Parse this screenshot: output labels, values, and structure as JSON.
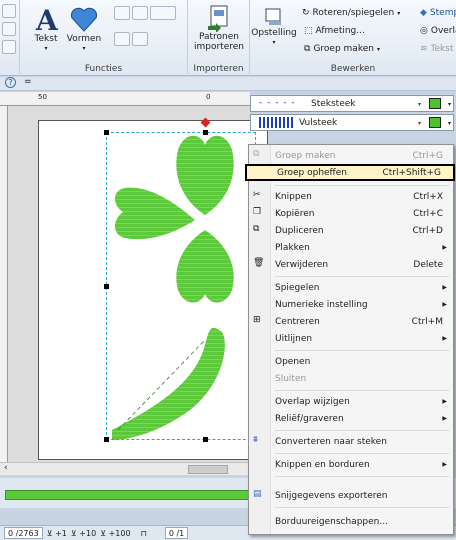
{
  "ribbon": {
    "functies": {
      "tekst": "Tekst",
      "vormen": "Vormen",
      "label": "Functies"
    },
    "importeren": {
      "patronen": "Patronen",
      "importeren_btn": "importeren",
      "label": "Importeren"
    },
    "bewerken": {
      "opstelling": "Opstelling",
      "roteren": "Roteren/spiegelen",
      "afmeting": "Afmeting...",
      "groep_maken": "Groep maken",
      "stempel": "Stempe",
      "overlap": "Overlap",
      "tekst_pl": "Tekst pl",
      "label": "Bewerken"
    }
  },
  "toolbar": {
    "help": "?",
    "dropdown": "="
  },
  "ruler": {
    "left": "50",
    "right": "0"
  },
  "stitches": {
    "line": "Steksteek",
    "fill": "Vulsteek"
  },
  "menu": {
    "items": [
      {
        "label": "Groep maken",
        "shortcut": "Ctrl+G",
        "disabled": true
      },
      {
        "label": "Groep opheffen",
        "shortcut": "Ctrl+Shift+G"
      },
      {
        "label": "Knippen",
        "shortcut": "Ctrl+X"
      },
      {
        "label": "Kopiëren",
        "shortcut": "Ctrl+C"
      },
      {
        "label": "Dupliceren",
        "shortcut": "Ctrl+D"
      },
      {
        "label": "Plakken"
      },
      {
        "label": "Verwijderen",
        "shortcut": "Delete"
      },
      {
        "label": "Spiegelen"
      },
      {
        "label": "Numerieke instelling"
      },
      {
        "label": "Centreren",
        "shortcut": "Ctrl+M"
      },
      {
        "label": "Uitlijnen"
      },
      {
        "label": "Openen"
      },
      {
        "label": "Sluiten",
        "disabled": true
      },
      {
        "label": "Overlap wijzigen"
      },
      {
        "label": "Reliëf/graveren"
      },
      {
        "label": "Converteren naar steken"
      },
      {
        "label": "Knippen en borduren"
      },
      {
        "label": "Snijgegevens exporteren"
      },
      {
        "label": "Borduureigenschappen..."
      }
    ]
  },
  "status": {
    "counter": "0 /2763",
    "b1": "+1",
    "b2": "+10",
    "b3": "+100",
    "page": "0 /1"
  },
  "colors": {
    "green": "#5cc93a",
    "accent": "#2aa7c8",
    "handle_red": "#e02020"
  }
}
